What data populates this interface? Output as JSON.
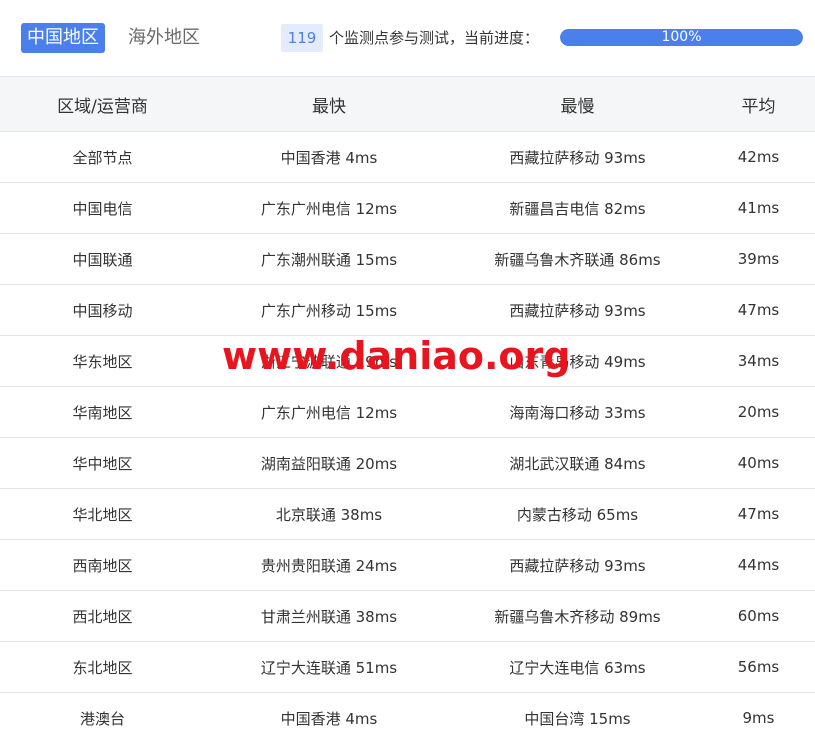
{
  "tabs": [
    {
      "label": "中国地区",
      "active": true
    },
    {
      "label": "海外地区",
      "active": false
    }
  ],
  "progress": {
    "node_count": "119",
    "text": "个监测点参与测试，当前进度：",
    "percent_label": "100%",
    "fraction": 1.0
  },
  "colors": {
    "accent": "#4a7fec",
    "watermark": "#e8141e"
  },
  "table": {
    "headers": [
      "区域/运营商",
      "最快",
      "最慢",
      "平均"
    ],
    "rows": [
      [
        "全部节点",
        "中国香港 4ms",
        "西藏拉萨移动 93ms",
        "42ms"
      ],
      [
        "中国电信",
        "广东广州电信 12ms",
        "新疆昌吉电信 82ms",
        "41ms"
      ],
      [
        "中国联通",
        "广东潮州联通 15ms",
        "新疆乌鲁木齐联通 86ms",
        "39ms"
      ],
      [
        "中国移动",
        "广东广州移动 15ms",
        "西藏拉萨移动 93ms",
        "47ms"
      ],
      [
        "华东地区",
        "浙江宁波联通 19ms",
        "山东青岛移动 49ms",
        "34ms"
      ],
      [
        "华南地区",
        "广东广州电信 12ms",
        "海南海口移动 33ms",
        "20ms"
      ],
      [
        "华中地区",
        "湖南益阳联通 20ms",
        "湖北武汉联通 84ms",
        "40ms"
      ],
      [
        "华北地区",
        "北京联通 38ms",
        "内蒙古移动 65ms",
        "47ms"
      ],
      [
        "西南地区",
        "贵州贵阳联通 24ms",
        "西藏拉萨移动 93ms",
        "44ms"
      ],
      [
        "西北地区",
        "甘肃兰州联通 38ms",
        "新疆乌鲁木齐移动 89ms",
        "60ms"
      ],
      [
        "东北地区",
        "辽宁大连联通 51ms",
        "辽宁大连电信 63ms",
        "56ms"
      ],
      [
        "港澳台",
        "中国香港 4ms",
        "中国台湾 15ms",
        "9ms"
      ]
    ]
  },
  "watermark": "www.daniao.org"
}
